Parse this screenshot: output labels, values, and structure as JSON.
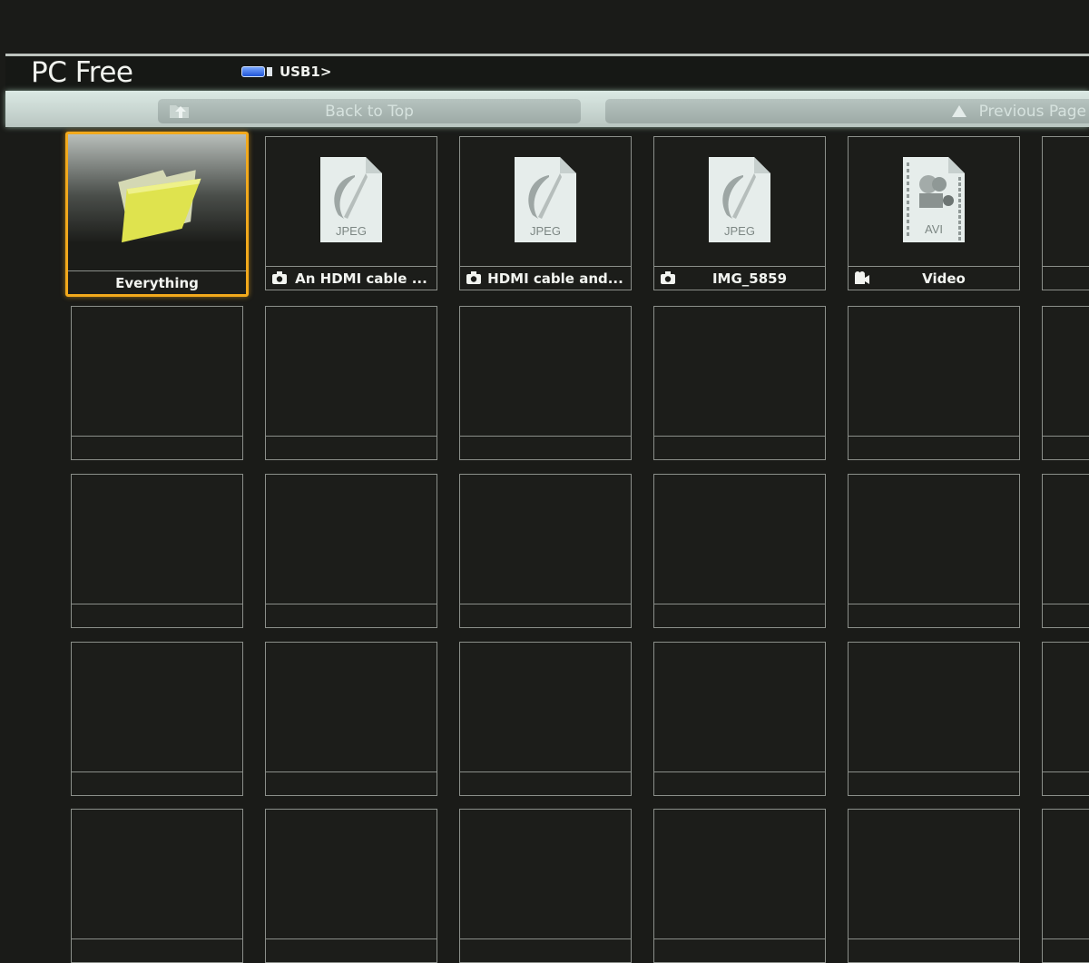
{
  "header": {
    "app_title": "PC Free",
    "source_icon": "usb-drive-icon",
    "source_label": "USB1>"
  },
  "navbar": {
    "back_to_top_label": "Back to Top",
    "back_to_top_icon": "folder-up-icon",
    "previous_page_label": "Previous Page",
    "previous_page_icon": "up-triangle-icon"
  },
  "colors": {
    "selection": "#f2a91c",
    "background": "#1a1b18",
    "cell_border": "#8b8f8a",
    "usb_blue": "#1f55d8"
  },
  "items": [
    {
      "label": "Everything",
      "type": "folder",
      "icon": "folder-icon",
      "caption_icon": null,
      "selected": true
    },
    {
      "label": "An HDMI cable ...",
      "type": "JPEG",
      "icon": "jpeg-file-icon",
      "caption_icon": "camera-icon",
      "selected": false
    },
    {
      "label": "HDMI cable and...",
      "type": "JPEG",
      "icon": "jpeg-file-icon",
      "caption_icon": "camera-icon",
      "selected": false
    },
    {
      "label": "IMG_5859",
      "type": "JPEG",
      "icon": "jpeg-file-icon",
      "caption_icon": "camera-icon",
      "selected": false
    },
    {
      "label": "Video",
      "type": "AVI",
      "icon": "avi-file-icon",
      "caption_icon": "video-camera-icon",
      "selected": false
    }
  ]
}
